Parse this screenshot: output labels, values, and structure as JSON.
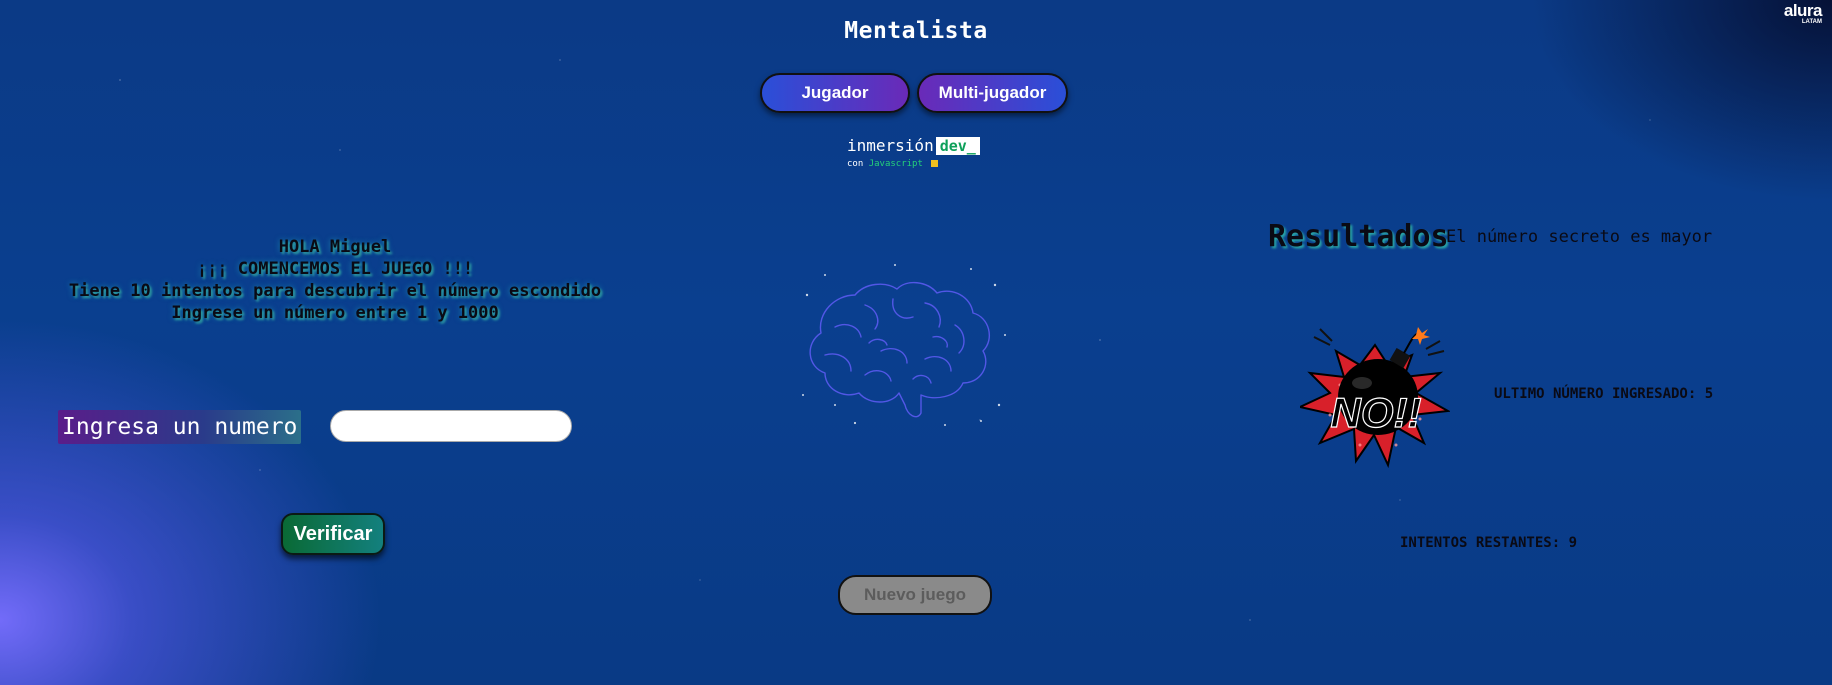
{
  "header": {
    "title": "Mentalista",
    "logo_line1": "alura",
    "logo_line2": "LATAM"
  },
  "modes": {
    "jugador_label": "Jugador",
    "multi_label": "Multi-jugador"
  },
  "badge": {
    "word": "inmersión",
    "dev": "dev_",
    "sub_prefix": "con",
    "sub_lang": "Javascript"
  },
  "intro": {
    "line1": "HOLA Miguel",
    "line2": "¡¡¡ COMENCEMOS EL JUEGO !!!",
    "line3": "Tiene 10 intentos para descubrir el número escondido",
    "line4": "Ingrese un número entre 1 y 1000"
  },
  "form": {
    "label": "Ingresa un numero",
    "input_value": "",
    "verify_label": "Verificar"
  },
  "controls": {
    "new_game_label": "Nuevo juego"
  },
  "results": {
    "heading": "Resultados",
    "message": "El número secreto es mayor",
    "bomb_text": "NO!!",
    "last_number": "ULTIMO NÚMERO INGRESADO: 5",
    "remaining": "INTENTOS RESTANTES: 9"
  },
  "colors": {
    "background": "#0a3f8f",
    "jugador_gradient_start": "#2a4fd8",
    "jugador_gradient_end": "#6a2ab8",
    "verify_green": "#0a6a35",
    "new_game_gray": "#8a8a8a",
    "text_glow": "#2f9ea0"
  }
}
